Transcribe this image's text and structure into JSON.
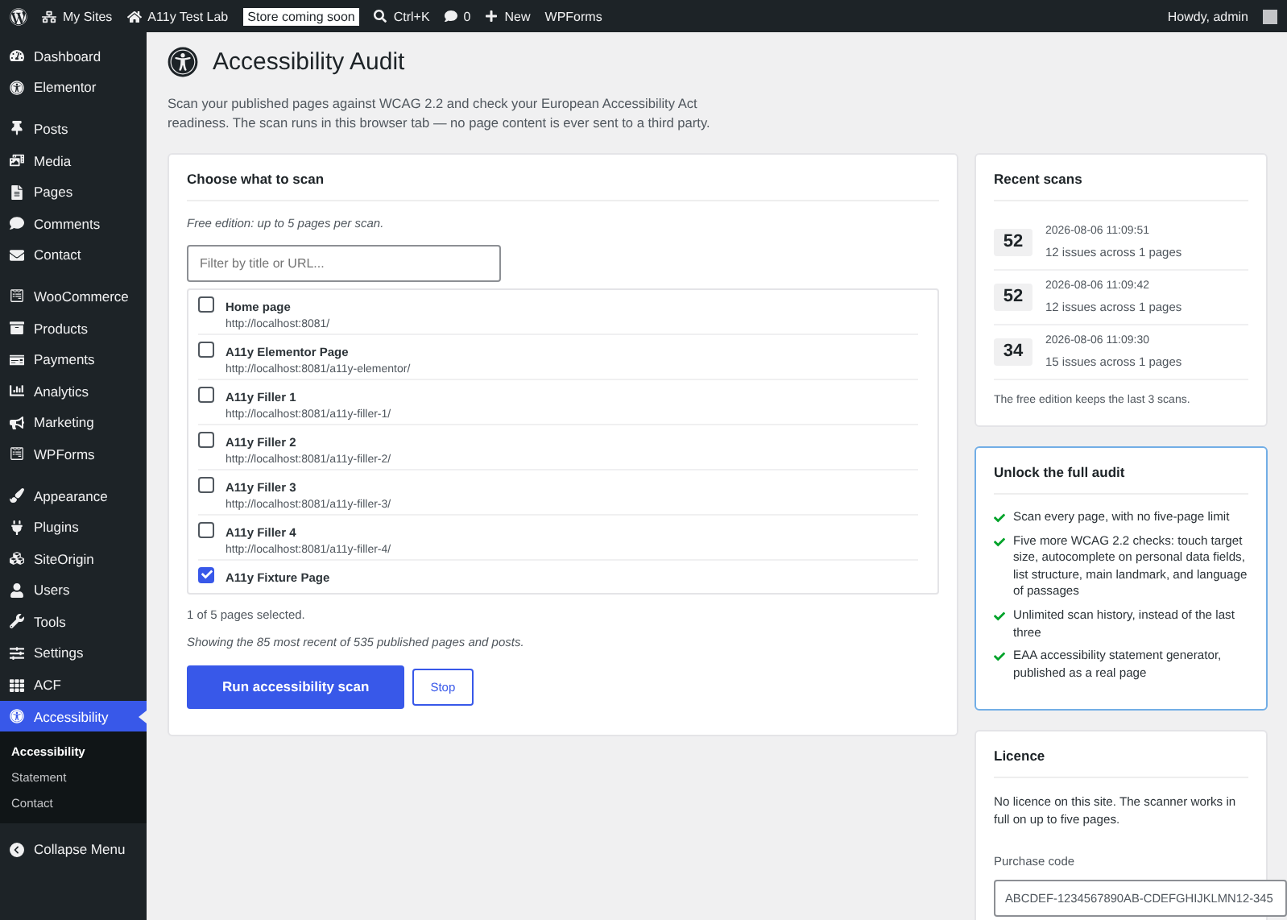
{
  "admin_bar": {
    "items": [
      {
        "kind": "sites",
        "label": "My Sites"
      },
      {
        "kind": "home",
        "label": "A11y Test Lab"
      },
      {
        "kind": "badge",
        "label": "Store coming soon"
      },
      {
        "kind": "search",
        "label": "Ctrl+K"
      },
      {
        "kind": "comments",
        "label": "0"
      },
      {
        "kind": "new",
        "label": "New"
      },
      {
        "kind": "plain",
        "label": "WPForms"
      }
    ],
    "greeting": "Howdy, admin"
  },
  "sidebar": {
    "groups": [
      [
        {
          "label": "Dashboard",
          "selected": false
        },
        {
          "label": "Elementor",
          "selected": false
        }
      ],
      [
        {
          "label": "Posts",
          "selected": false
        },
        {
          "label": "Media",
          "selected": false
        },
        {
          "label": "Pages",
          "selected": false
        },
        {
          "label": "Comments",
          "selected": false
        },
        {
          "label": "Contact",
          "selected": false
        }
      ],
      [
        {
          "label": "WooCommerce",
          "selected": false
        },
        {
          "label": "Products",
          "selected": false
        },
        {
          "label": "Payments",
          "selected": false
        },
        {
          "label": "Analytics",
          "selected": false
        },
        {
          "label": "Marketing",
          "selected": false
        },
        {
          "label": "WPForms",
          "selected": false
        }
      ],
      [
        {
          "label": "Appearance",
          "selected": false
        },
        {
          "label": "Plugins",
          "selected": false
        },
        {
          "label": "SiteOrigin",
          "selected": false
        },
        {
          "label": "Users",
          "selected": false
        },
        {
          "label": "Tools",
          "selected": false
        },
        {
          "label": "Settings",
          "selected": false
        },
        {
          "label": "ACF",
          "selected": false
        },
        {
          "label": "Accessibility",
          "selected": true,
          "children": [
            {
              "label": "Accessibility",
              "selected": true
            },
            {
              "label": "Statement",
              "selected": false
            },
            {
              "label": "Contact",
              "selected": false
            }
          ]
        }
      ]
    ],
    "collapse": "Collapse Menu"
  },
  "page": {
    "title": "Accessibility Audit",
    "description": "Scan your published pages against WCAG 2.2 and check your European Accessibility Act readiness. The scan runs in this browser tab — no page content is ever sent to a third party."
  },
  "scan_card": {
    "title": "Choose what to scan",
    "note": "Free edition: up to 5 pages per scan.",
    "filter": {
      "placeholder": "Filter by title or URL..."
    },
    "pages": [
      {
        "title": "Home page",
        "url": "http://localhost:8081/",
        "checked": false
      },
      {
        "title": "A11y Elementor Page",
        "url": "http://localhost:8081/a11y-elementor/",
        "checked": false
      },
      {
        "title": "A11y Filler 1",
        "url": "http://localhost:8081/a11y-filler-1/",
        "checked": false
      },
      {
        "title": "A11y Filler 2",
        "url": "http://localhost:8081/a11y-filler-2/",
        "checked": false
      },
      {
        "title": "A11y Filler 3",
        "url": "http://localhost:8081/a11y-filler-3/",
        "checked": false
      },
      {
        "title": "A11y Filler 4",
        "url": "http://localhost:8081/a11y-filler-4/",
        "checked": false
      },
      {
        "title": "A11y Fixture Page",
        "checked": true
      }
    ],
    "selected_count": "1 of 5 pages selected.",
    "showing": "Showing the 85 most recent of 535 published pages and posts.",
    "buttons": [
      {
        "kind": "primary",
        "label": "Run accessibility scan"
      },
      {
        "kind": "secondary",
        "label": "Stop"
      }
    ]
  },
  "recent_scans": {
    "title": "Recent scans",
    "scans": [
      {
        "score": "52",
        "date": "2026-08-06 11:09:51",
        "summary": "12 issues across 1 pages"
      },
      {
        "score": "52",
        "date": "2026-08-06 11:09:42",
        "summary": "12 issues across 1 pages"
      },
      {
        "score": "34",
        "date": "2026-08-06 11:09:30",
        "summary": "15 issues across 1 pages"
      }
    ],
    "footer": "The free edition keeps the last 3 scans."
  },
  "unlock": {
    "title": "Unlock the full audit",
    "features": [
      "Scan every page, with no five-page limit",
      "Five more WCAG 2.2 checks: touch target size, autocomplete on personal data fields, list structure, main landmark, and language of passages",
      "Unlimited scan history, instead of the last three",
      "EAA accessibility statement generator, published as a real page"
    ]
  },
  "licence": {
    "title": "Licence",
    "text": "No licence on this site. The scanner works in full on up to five pages.",
    "code_label": "Purchase code",
    "code_value": "ABCDEF-1234567890AB-CDEFGHIJKLMN12-345"
  }
}
